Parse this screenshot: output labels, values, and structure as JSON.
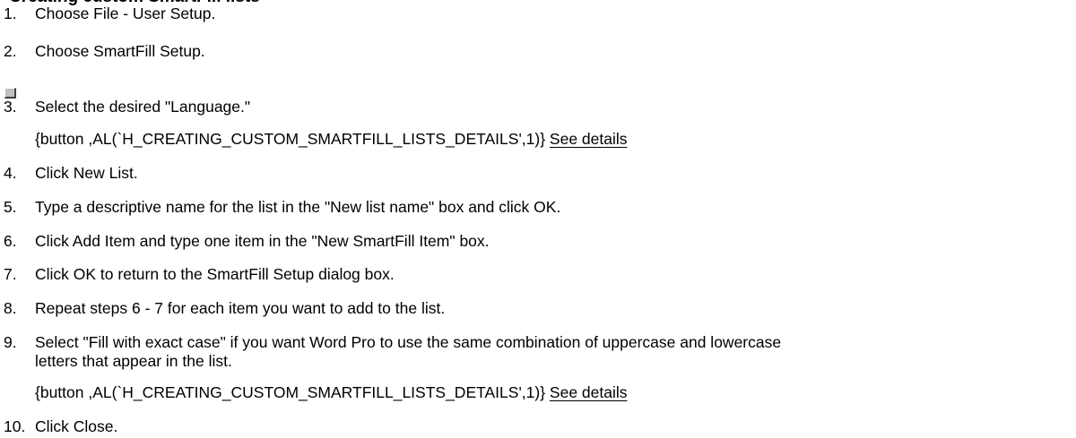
{
  "heading": "Creating custom SmartFill lists",
  "steps": [
    {
      "num": "1.",
      "text": "Choose File - User Setup."
    },
    {
      "num": "2.",
      "text": "Choose SmartFill Setup."
    },
    {
      "num": "3.",
      "text": "Select the desired \"Language.\""
    },
    {
      "num": "4.",
      "text": "Click New List."
    },
    {
      "num": "5.",
      "text": "Type a descriptive name for the list in the \"New list name\" box and click OK."
    },
    {
      "num": "6.",
      "text": "Click Add Item and type one item in the \"New SmartFill Item\" box."
    },
    {
      "num": "7.",
      "text": "Click OK to return to the SmartFill Setup dialog box."
    },
    {
      "num": "8.",
      "text": "Repeat steps 6 - 7 for each item you want to add to the list."
    },
    {
      "num": "9.",
      "text": "Select \"Fill with exact case\" if you want Word Pro to use the same combination of uppercase and lowercase",
      "text_cont": "letters that appear in the list."
    },
    {
      "num": "10.",
      "text": "Click Close."
    }
  ],
  "macro_text": "{button ,AL(`H_CREATING_CUSTOM_SMARTFILL_LISTS_DETAILS',1)} ",
  "link_label": "See details",
  "icon_names": {
    "button": "button-graphic-icon"
  }
}
